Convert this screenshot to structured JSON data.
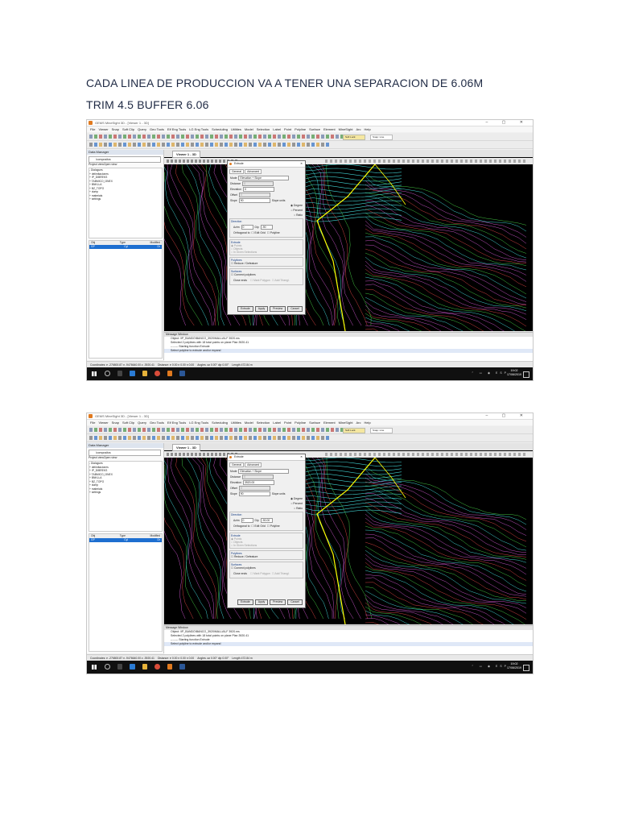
{
  "heading1": "CADA LINEA DE PRODUCCION VA A TENER UNA SEPARACION DE 6.06M",
  "heading2": "TRIM 4.5 BUFFER 6.06",
  "screenshots": [
    {
      "window_title": "GEMS MineSight 3D - [Viewer 1 - 3D]",
      "menu": [
        "File",
        "Viewer",
        "Snap",
        "Soft Clip",
        "Query",
        "Geo Tools",
        "Elf Eng Tools",
        "LG Eng Tools",
        "Scheduling",
        "Utilities",
        "Model",
        "Selection",
        "Label",
        "Point",
        "Polyline",
        "Surface",
        "Element",
        "MineSight",
        "Arc",
        "Help"
      ],
      "toolbar_dropdown_1": "Soft Lock",
      "toolbar_dropdown_2": "Snap: Line",
      "data_manager": {
        "title": "Data Manager",
        "project_path": "\\compositos",
        "tabs": [
          "Project view",
          "Open view"
        ],
        "tree": [
          "- Dialogues",
          "+ delimitaciones",
          "+ IP_DIBREKS",
          "+ TABMICO_I3NEX",
          "+ BNKLLA",
          "+ BZ_TOPO",
          "+ dump",
          "+ materials",
          "+ settings"
        ],
        "list_columns": [
          "Obj",
          "Type",
          "Modified"
        ],
        "list_row": [
          "GP",
          "Cyl",
          "Dr"
        ]
      },
      "viewer_tab": "Viewer 1 - 3D",
      "dialog": {
        "title": "Extrude",
        "tabs": [
          "General",
          "Advanced"
        ],
        "mode_label": "Mode",
        "mode_value": "Elevation + Slope",
        "distance_label": "Distance",
        "distance_value": "0",
        "elevation_label": "Elevation",
        "elevation_value": "0",
        "offset_label": "Offset",
        "offset_value": "0",
        "slope_label": "Slope",
        "slope_value": "90",
        "slope_units_label": "Slope units",
        "slope_units": [
          "Degree",
          "Percent",
          "Ratio"
        ],
        "direction_label": "Direction",
        "azim_label": "Azim",
        "azim_value": "0",
        "dip_label": "Dip",
        "dip_value": "-90",
        "orthogonal_label": "Orthogonal to",
        "edit_grid": "Edit Grid",
        "polyline_opt": "Polyline",
        "extrude_label": "Extrude",
        "extrude_opts": [
          "Points",
          "Objects",
          "In Given Selections"
        ],
        "polylines_label": "Polylines",
        "reduce_label": "Reduce / Defeature",
        "surfaces_label": "Surfaces",
        "connect_label": "Connect polylines",
        "close_ends_label": "Close ends",
        "close_ends_opts": [
          "Mark Polygon",
          "Add Triangl."
        ],
        "buttons": [
          "Extrude",
          "Apply",
          "Preview",
          "Cancel"
        ]
      },
      "messages": {
        "title": "Message Window",
        "lines": [
          "Object: \\IP_BANDO\\BANCO_3920\\MALLA\\LF 3920.ms",
          "Selected 2 polylines with 18 total points on plane Plan 3920.41",
          "-------- Starting function Extrude",
          "Select polyline to extrude and/or expand"
        ]
      },
      "status": [
        "Coordinates: e -276800.87 n -9476640.00 z -3920.41",
        "Distance: e 0.00 n 0.00 n 0.00",
        "Angles: az 0.00° dip 0.00°",
        "Length 472.84 m"
      ],
      "clock_time": "19:02",
      "clock_date": "17/06/2019"
    },
    {
      "window_title": "GEMS MineSight 3D - [Viewer 1 - 3D]",
      "menu": [
        "File",
        "Viewer",
        "Snap",
        "Soft Clip",
        "Query",
        "Geo Tools",
        "Elf Eng Tools",
        "LG Eng Tools",
        "Scheduling",
        "Utilities",
        "Model",
        "Selection",
        "Label",
        "Point",
        "Polyline",
        "Surface",
        "Element",
        "MineSight",
        "Arc",
        "Help"
      ],
      "toolbar_dropdown_1": "Soft Lock",
      "toolbar_dropdown_2": "Snap: Line",
      "data_manager": {
        "title": "Data Manager",
        "project_path": "\\compositos",
        "tabs": [
          "Project view",
          "Open view"
        ],
        "tree": [
          "- Dialogues",
          "+ delimitaciones",
          "+ IP_DIBREKS",
          "+ TABMICO_I3NEX",
          "+ BNKLLA",
          "+ BZ_TOPO",
          "+ dump",
          "+ materials",
          "+ settings"
        ],
        "list_columns": [
          "Obj",
          "Type",
          "Modified"
        ],
        "list_row": [
          "GP",
          "Cyl",
          "Dr"
        ]
      },
      "viewer_tab": "Viewer 1 - 3D",
      "dialog": {
        "title": "Extrude",
        "tabs": [
          "General",
          "Advanced"
        ],
        "mode_label": "Mode",
        "mode_value": "Elevation + Slope",
        "distance_label": "Distance",
        "distance_value": "0",
        "elevation_label": "Elevation",
        "elevation_value": "3920.00",
        "offset_label": "Offset",
        "offset_value": "0",
        "slope_label": "Slope",
        "slope_value": "90",
        "slope_units_label": "Slope units",
        "slope_units": [
          "Degree",
          "Percent",
          "Ratio"
        ],
        "direction_label": "Direction",
        "azim_label": "Azim",
        "azim_value": "0",
        "dip_label": "Dip",
        "dip_value": "-90.00",
        "orthogonal_label": "Orthogonal to",
        "edit_grid": "Edit Grid",
        "polyline_opt": "Polyline",
        "extrude_label": "Extrude",
        "extrude_opts": [
          "Points",
          "Objects",
          "In Given Selections"
        ],
        "polylines_label": "Polylines",
        "reduce_label": "Reduce / Defeature",
        "surfaces_label": "Surfaces",
        "connect_label": "Connect polylines",
        "close_ends_label": "Close ends",
        "close_ends_opts": [
          "Mark Polygon",
          "Add Triangl."
        ],
        "buttons": [
          "Extrude",
          "Apply",
          "Preview",
          "Cancel"
        ]
      },
      "messages": {
        "title": "Message Window",
        "lines": [
          "Object: \\IP_BANDO\\BANCO_3920\\MALLA\\LF 3920.ms",
          "Selected 2 polylines with 18 total points on plane Plan 3920.41",
          "-------- Starting function Extrude",
          "Select polyline to extrude and/or expand"
        ]
      },
      "status": [
        "Coordinates: e -276800.87 n -9476640.00 z -3920.41",
        "Distance: e 0.00 n 0.00 n 0.00",
        "Angles: az 0.00° dip 0.00°",
        "Length 472.84 m"
      ],
      "clock_time": "19:02",
      "clock_date": "17/06/2019"
    }
  ],
  "colors": {
    "heading": "#1f2a44",
    "viewer_bg": "#000000",
    "contour_cyan": "#40d0d0",
    "contour_magenta": "#c050c0",
    "contour_red": "#d04040",
    "contour_green": "#40c040",
    "polygon_yellow": "#ffff00",
    "selection_blue": "#1e6fd0"
  }
}
